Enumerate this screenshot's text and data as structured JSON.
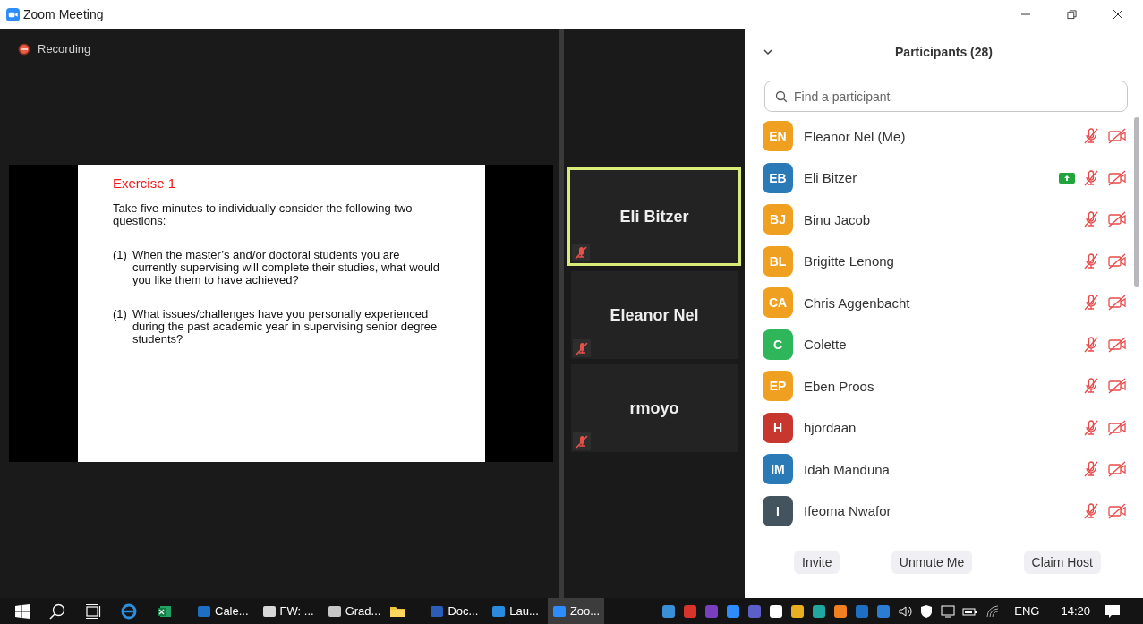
{
  "window": {
    "title": "Zoom Meeting"
  },
  "recording": {
    "label": "Recording",
    "on": true
  },
  "slide": {
    "title": "Exercise 1",
    "intro": "Take five minutes to individually consider the following two questions:",
    "questions": [
      {
        "number": "(1)",
        "text": "When the master’s and/or doctoral students you are currently supervising will complete their studies, what would you like them to have achieved?"
      },
      {
        "number": "(1)",
        "text": "What issues/challenges have you personally experienced during the past academic year in supervising senior degree students?"
      }
    ]
  },
  "video_tiles": [
    {
      "name": "Eli Bitzer",
      "speaking": true,
      "muted": true
    },
    {
      "name": "Eleanor Nel",
      "speaking": false,
      "muted": true
    },
    {
      "name": "rmoyo",
      "speaking": false,
      "muted": true
    }
  ],
  "participants_panel": {
    "title": "Participants (28)",
    "search": {
      "placeholder": "Find a participant"
    },
    "participants": [
      {
        "initials": "EN",
        "name": "Eleanor Nel (Me)",
        "color": "#f0a020",
        "sharing": false,
        "muted": true,
        "video_off": true
      },
      {
        "initials": "EB",
        "name": "Eli Bitzer",
        "color": "#2a7ab8",
        "sharing": true,
        "muted": true,
        "video_off": true
      },
      {
        "initials": "BJ",
        "name": "Binu Jacob",
        "color": "#f0a020",
        "sharing": false,
        "muted": true,
        "video_off": true
      },
      {
        "initials": "BL",
        "name": "Brigitte Lenong",
        "color": "#f0a020",
        "sharing": false,
        "muted": true,
        "video_off": true
      },
      {
        "initials": "CA",
        "name": "Chris Aggenbacht",
        "color": "#f0a020",
        "sharing": false,
        "muted": true,
        "video_off": true
      },
      {
        "initials": "C",
        "name": "Colette",
        "color": "#2fb55a",
        "sharing": false,
        "muted": true,
        "video_off": true
      },
      {
        "initials": "EP",
        "name": "Eben Proos",
        "color": "#f0a020",
        "sharing": false,
        "muted": true,
        "video_off": true
      },
      {
        "initials": "H",
        "name": "hjordaan",
        "color": "#c8372d",
        "sharing": false,
        "muted": true,
        "video_off": true
      },
      {
        "initials": "IM",
        "name": "Idah Manduna",
        "color": "#2a7ab8",
        "sharing": false,
        "muted": true,
        "video_off": true
      },
      {
        "initials": "I",
        "name": "Ifeoma Nwafor",
        "color": "#44545f",
        "sharing": false,
        "muted": true,
        "video_off": true
      }
    ],
    "buttons": [
      "Invite",
      "Unmute Me",
      "Claim Host"
    ]
  },
  "taskbar": {
    "apps": [
      {
        "label": "Cale...",
        "color": "#1e6fc4",
        "selected": false
      },
      {
        "label": "FW: ...",
        "color": "#d8d8d8",
        "selected": false
      },
      {
        "label": "Grad...",
        "color": "#c8c8c8",
        "selected": false
      },
      {
        "label": "Doc...",
        "color": "#2b5cb8",
        "selected": false
      },
      {
        "label": "Lau...",
        "color": "#2a8ae0",
        "selected": false
      },
      {
        "label": "Zoo...",
        "color": "#2d8cff",
        "selected": true
      }
    ],
    "language": "ENG",
    "time": "14:20"
  }
}
